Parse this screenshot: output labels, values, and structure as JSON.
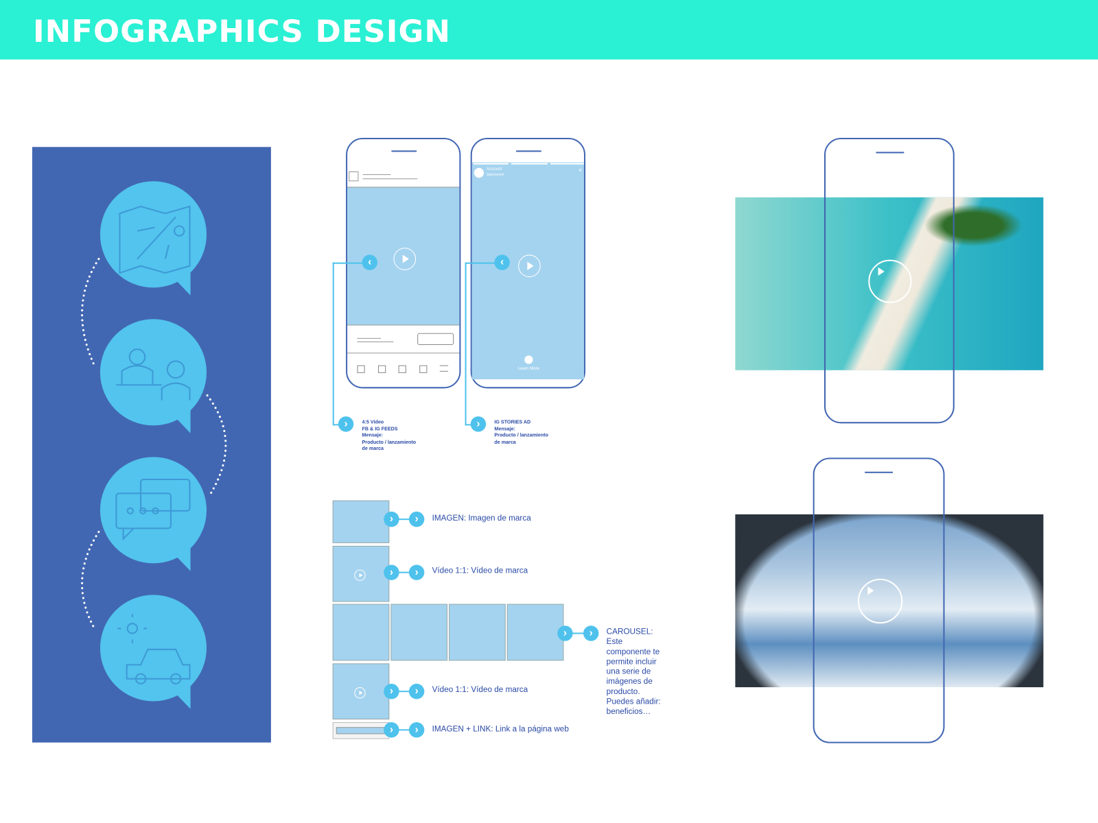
{
  "header": {
    "title": "INFOGRAPHICS DESIGN",
    "color": "#2af0d4"
  },
  "left_panel": {
    "color": "#4267b2",
    "bubble_color": "#52c4ee",
    "bubbles": [
      {
        "icon": "map-airplane-icon"
      },
      {
        "icon": "people-icon"
      },
      {
        "icon": "chat-icon"
      },
      {
        "icon": "car-sun-icon"
      }
    ]
  },
  "feed_phone": {
    "caption": [
      "4:5 Video",
      "FB & IG FEEDS",
      "Mensaje:",
      "Producto / lanzamiento",
      "de marca"
    ]
  },
  "stories_phone": {
    "account": "Account",
    "sponsored": "Sponsored",
    "close": "×",
    "learn_more": "Learn More",
    "caption": [
      "IG STORIES AD",
      "Mensaje:",
      "Producto / lanzamiento",
      "de marca"
    ]
  },
  "components": {
    "imagen": "IMAGEN: Imagen de marca",
    "video1": "Vídeo 1:1: Vídeo de marca",
    "carousel": [
      "CAROUSEL:",
      "Este",
      "componente te",
      "permite incluir",
      "una serie de",
      "imágenes de",
      "producto.",
      "Puedes añadir:",
      "beneficios…"
    ],
    "video2": "Vídeo 1:1: Vídeo de marca",
    "link": "IMAGEN + LINK: Link a la página web"
  },
  "photos": [
    {
      "subject": "tropical island aerial"
    },
    {
      "subject": "airplane window clouds"
    }
  ]
}
